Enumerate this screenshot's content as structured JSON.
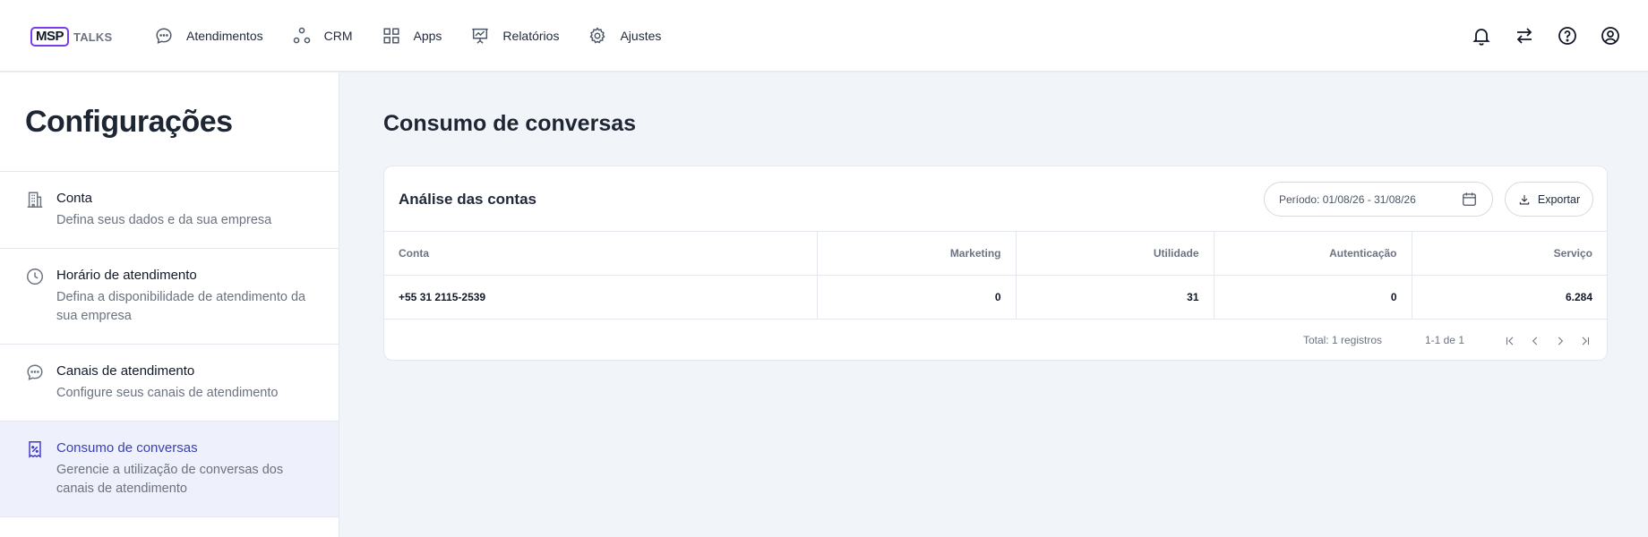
{
  "brand": {
    "logo_box": "MSP",
    "logo_text": "TALKS"
  },
  "nav": {
    "items": [
      {
        "label": "Atendimentos",
        "icon": "chat-bubble-icon"
      },
      {
        "label": "CRM",
        "icon": "nodes-icon"
      },
      {
        "label": "Apps",
        "icon": "grid-icon"
      },
      {
        "label": "Relatórios",
        "icon": "presentation-chart-icon"
      },
      {
        "label": "Ajustes",
        "icon": "gear-icon"
      }
    ],
    "actions": [
      "bell-icon",
      "swap-arrows-icon",
      "help-icon",
      "user-circle-icon"
    ]
  },
  "sidebar": {
    "title": "Configurações",
    "items": [
      {
        "title": "Conta",
        "description": "Defina seus dados e da sua empresa",
        "icon": "building-icon",
        "active": false
      },
      {
        "title": "Horário de atendimento",
        "description": "Defina a disponibilidade de atendimento da sua empresa",
        "icon": "clock-icon",
        "active": false
      },
      {
        "title": "Canais de atendimento",
        "description": "Configure seus canais de atendimento",
        "icon": "chat-bubble-icon",
        "active": false
      },
      {
        "title": "Consumo de conversas",
        "description": "Gerencie a utilização de conversas dos canais de atendimento",
        "icon": "receipt-percent-icon",
        "active": true
      }
    ]
  },
  "main": {
    "title": "Consumo de conversas",
    "card": {
      "title": "Análise das contas",
      "period_label": "Período: 01/08/26 - 31/08/26",
      "export_label": "Exportar",
      "columns": [
        "Conta",
        "Marketing",
        "Utilidade",
        "Autenticação",
        "Serviço"
      ],
      "rows": [
        [
          "+55 31 2115-2539",
          "0",
          "31",
          "0",
          "6.284"
        ]
      ],
      "total_label": "Total: 1 registros",
      "range_label": "1-1 de 1"
    }
  },
  "colors": {
    "accent": "#4338ca",
    "active_bg": "#eef1fb",
    "page_bg": "#f1f4f9"
  }
}
